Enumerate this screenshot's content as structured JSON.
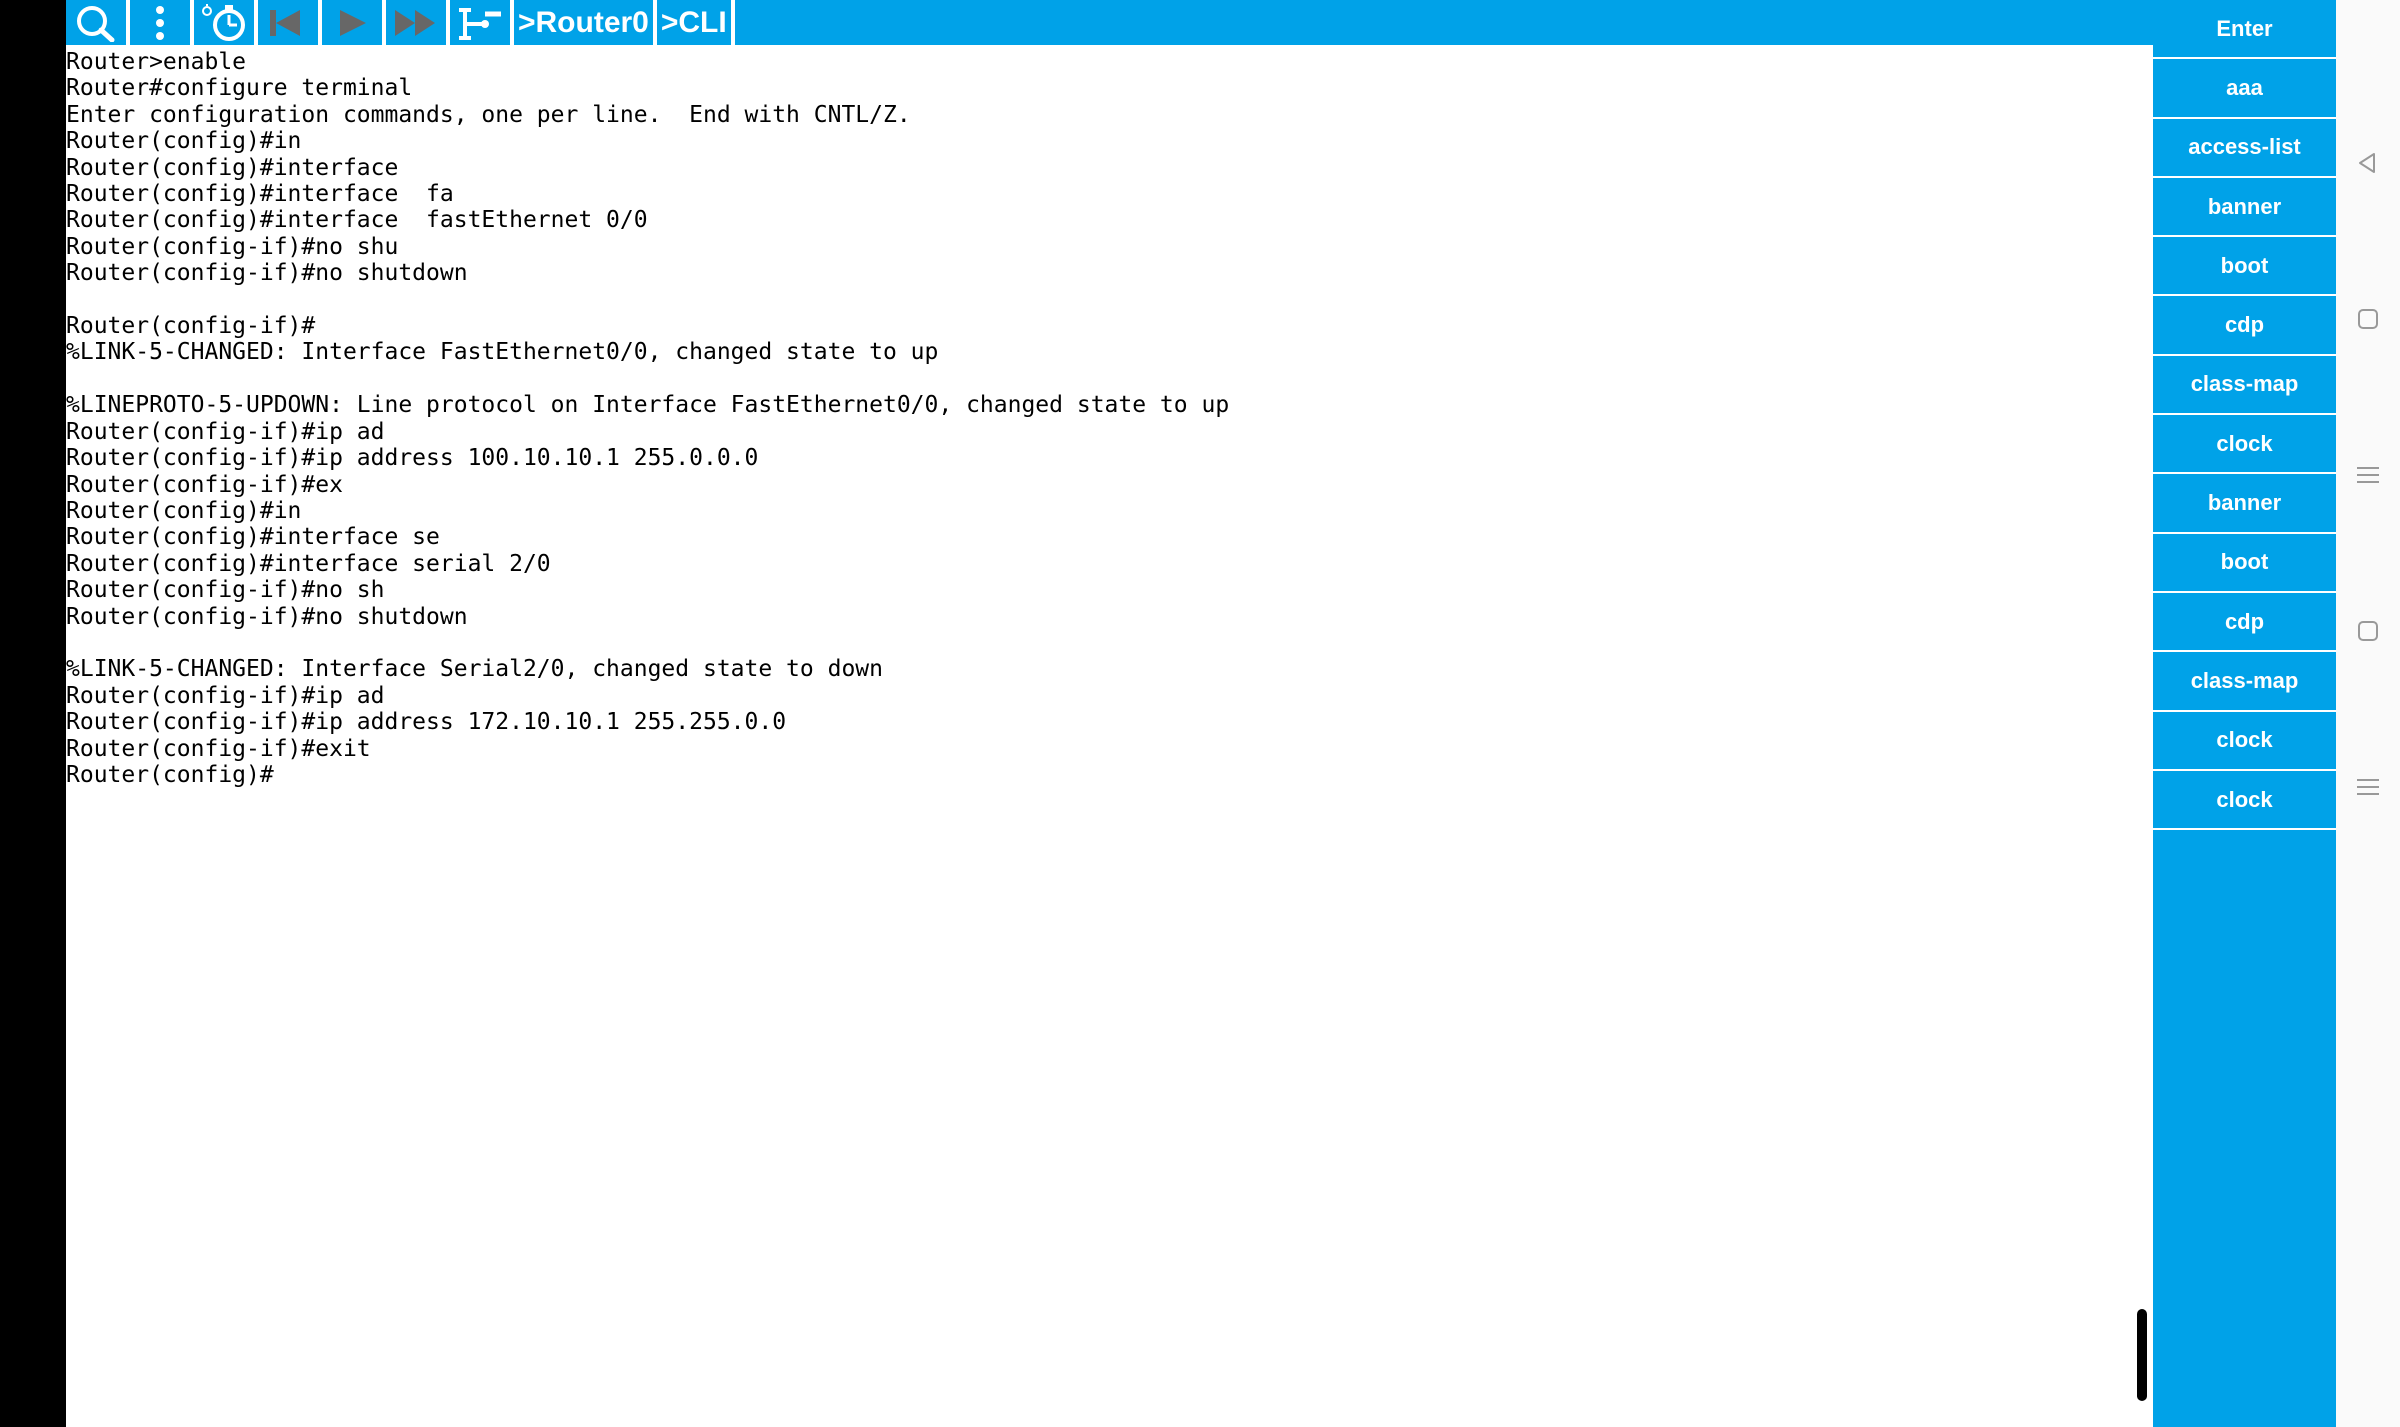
{
  "toolbar": {
    "breadcrumb": [
      ">Router0",
      ">CLI"
    ]
  },
  "terminal": {
    "output": "Router>enable\nRouter#configure terminal\nEnter configuration commands, one per line.  End with CNTL/Z.\nRouter(config)#in\nRouter(config)#interface\nRouter(config)#interface  fa\nRouter(config)#interface  fastEthernet 0/0\nRouter(config-if)#no shu\nRouter(config-if)#no shutdown\n\nRouter(config-if)#\n%LINK-5-CHANGED: Interface FastEthernet0/0, changed state to up\n\n%LINEPROTO-5-UPDOWN: Line protocol on Interface FastEthernet0/0, changed state to up\nRouter(config-if)#ip ad\nRouter(config-if)#ip address 100.10.10.1 255.0.0.0\nRouter(config-if)#ex\nRouter(config)#in\nRouter(config)#interface se\nRouter(config)#interface serial 2/0\nRouter(config-if)#no sh\nRouter(config-if)#no shutdown\n\n%LINK-5-CHANGED: Interface Serial2/0, changed state to down\nRouter(config-if)#ip ad\nRouter(config-if)#ip address 172.10.10.1 255.255.0.0\nRouter(config-if)#exit\nRouter(config)#"
  },
  "commands": [
    "Enter",
    "aaa",
    "access-list",
    "banner",
    "boot",
    "cdp",
    "class-map",
    "clock",
    "banner",
    "boot",
    "cdp",
    "class-map",
    "clock",
    "clock"
  ]
}
